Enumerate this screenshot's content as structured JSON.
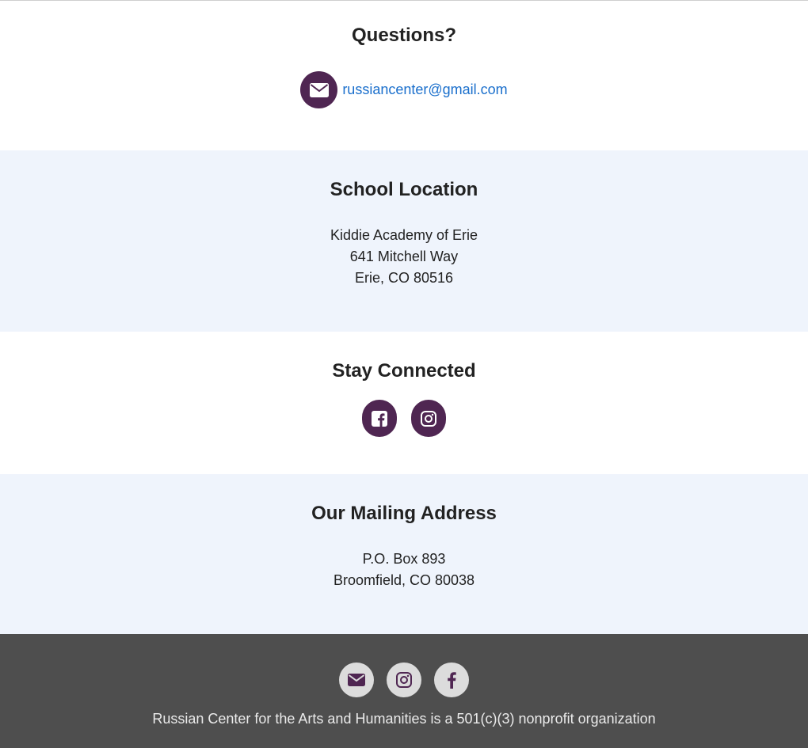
{
  "colors": {
    "accent_purple": "#4f2652",
    "link_blue": "#1a6fcc",
    "tint_background": "#eff4fc",
    "footer_background": "#4e4e4e",
    "footer_icon_background": "#dcdcdc"
  },
  "questions": {
    "title": "Questions?",
    "email_icon": "envelope-icon",
    "email": "russiancenter@gmail.com"
  },
  "school_location": {
    "title": "School Location",
    "lines": [
      "Kiddie Academy of Erie",
      "641 Mitchell Way",
      "Erie, CO 80516"
    ]
  },
  "stay_connected": {
    "title": "Stay Connected",
    "icons": [
      "facebook-square-icon",
      "instagram-icon"
    ]
  },
  "mailing_address": {
    "title": "Our Mailing Address",
    "lines": [
      "P.O. Box 893",
      "Broomfield, CO 80038"
    ]
  },
  "footer": {
    "icons": [
      "envelope-icon",
      "instagram-icon",
      "facebook-icon"
    ],
    "text": "Russian Center for the Arts and Humanities is a 501(c)(3) nonprofit organization"
  }
}
